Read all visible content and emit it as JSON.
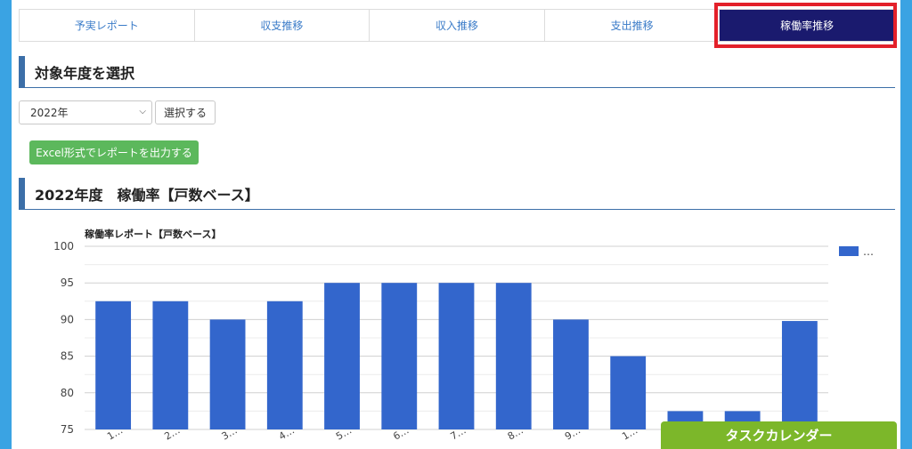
{
  "tabs": [
    {
      "label": "予実レポート"
    },
    {
      "label": "収支推移"
    },
    {
      "label": "収入推移"
    },
    {
      "label": "支出推移"
    },
    {
      "label": "稼働率推移"
    }
  ],
  "year_section": {
    "title": "対象年度を選択"
  },
  "year_select": {
    "value": "2022年"
  },
  "select_button": {
    "label": "選択する"
  },
  "excel_button": {
    "label": "Excel形式でレポートを出力する"
  },
  "report_section": {
    "title": "2022年度　稼働率【戸数ベース】"
  },
  "task_calendar": {
    "label": "タスクカレンダー"
  },
  "colors": {
    "bar": "#3366cc",
    "tab_active": "#1a1a6e",
    "highlight": "#e3202a"
  },
  "chart_data": {
    "type": "bar",
    "title": "稼働率レポート【戸数ベース】",
    "categories": [
      "1…",
      "2…",
      "3…",
      "4…",
      "5…",
      "6…",
      "7…",
      "8…",
      "9…",
      "1…",
      "",
      "",
      ""
    ],
    "series": [
      {
        "name": "…",
        "values": [
          92.5,
          92.5,
          90,
          92.5,
          95,
          95,
          95,
          95,
          90,
          85,
          77.5,
          77.5,
          89.8
        ]
      }
    ],
    "ylim": [
      75,
      100
    ],
    "yticks": [
      75,
      80,
      85,
      90,
      95,
      100
    ],
    "grid": true,
    "legend": "right"
  }
}
